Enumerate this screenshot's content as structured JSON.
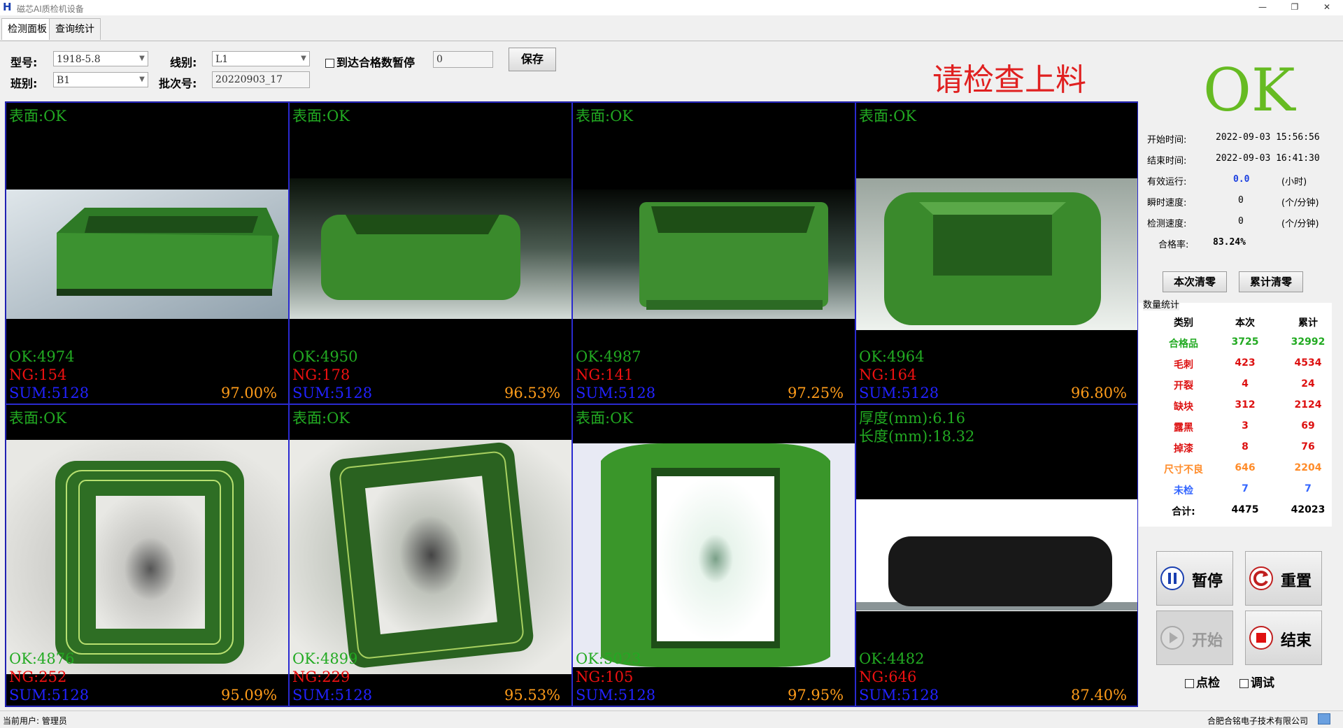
{
  "window": {
    "logo": "H",
    "title": "磁芯AI质检机设备",
    "min": "—",
    "restore": "❐",
    "close": "✕"
  },
  "tabs": [
    "检测面板",
    "查询统计"
  ],
  "form": {
    "model_label": "型号:",
    "model_value": "1918-5.8",
    "line_label": "线别:",
    "line_value": "L1",
    "shift_label": "班别:",
    "shift_value": "B1",
    "batch_label": "批次号:",
    "batch_value": "20220903_17",
    "pause_label": "到达合格数暂停",
    "pause_value": "0",
    "save_label": "保存"
  },
  "warning": "请检查上料",
  "result": "OK",
  "cameras": [
    {
      "top": "表面:OK",
      "top2": "",
      "ok": "OK:4974",
      "ng": "NG:154",
      "sum": "SUM:5128",
      "rate": "97.00%"
    },
    {
      "top": "表面:OK",
      "top2": "",
      "ok": "OK:4950",
      "ng": "NG:178",
      "sum": "SUM:5128",
      "rate": "96.53%"
    },
    {
      "top": "表面:OK",
      "top2": "",
      "ok": "OK:4987",
      "ng": "NG:141",
      "sum": "SUM:5128",
      "rate": "97.25%"
    },
    {
      "top": "表面:OK",
      "top2": "",
      "ok": "OK:4964",
      "ng": "NG:164",
      "sum": "SUM:5128",
      "rate": "96.80%"
    },
    {
      "top": "表面:OK",
      "top2": "",
      "ok": "OK:4876",
      "ng": "NG:252",
      "sum": "SUM:5128",
      "rate": "95.09%"
    },
    {
      "top": "表面:OK",
      "top2": "",
      "ok": "OK:4899",
      "ng": "NG:229",
      "sum": "SUM:5128",
      "rate": "95.53%"
    },
    {
      "top": "表面:OK",
      "top2": "",
      "ok": "OK:5023",
      "ng": "NG:105",
      "sum": "SUM:5128",
      "rate": "97.95%"
    },
    {
      "top": "厚度(mm):6.16",
      "top2": "长度(mm):18.32",
      "ok": "OK:4482",
      "ng": "NG:646",
      "sum": "SUM:5128",
      "rate": "87.40%"
    }
  ],
  "info": {
    "start_label": "开始时间:",
    "start_value": "2022-09-03 15:56:56",
    "end_label": "结束时间:",
    "end_value": "2022-09-03 16:41:30",
    "run_label": "有效运行:",
    "run_value": "0.0",
    "run_unit": "(小时)",
    "inst_label": "瞬时速度:",
    "inst_value": "0",
    "inst_unit": "(个/分钟)",
    "det_label": "检测速度:",
    "det_value": "0",
    "det_unit": "(个/分钟)",
    "rate_label": "合格率:",
    "rate_value": "83.24%"
  },
  "reset_buttons": {
    "current": "本次清零",
    "total": "累计清零"
  },
  "stats": {
    "title": "数量统计",
    "headers": [
      "类别",
      "本次",
      "累计"
    ],
    "rows": [
      {
        "name": "合格品",
        "cur": "3725",
        "total": "32992",
        "color": "#22aa22"
      },
      {
        "name": "毛刺",
        "cur": "423",
        "total": "4534",
        "color": "#dd1111"
      },
      {
        "name": "开裂",
        "cur": "4",
        "total": "24",
        "color": "#dd1111"
      },
      {
        "name": "缺块",
        "cur": "312",
        "total": "2124",
        "color": "#dd1111"
      },
      {
        "name": "露黑",
        "cur": "3",
        "total": "69",
        "color": "#dd1111"
      },
      {
        "name": "掉漆",
        "cur": "8",
        "total": "76",
        "color": "#dd1111"
      },
      {
        "name": "尺寸不良",
        "cur": "646",
        "total": "2204",
        "color": "#ff8c2a"
      },
      {
        "name": "未检",
        "cur": "7",
        "total": "7",
        "color": "#3366ff"
      }
    ],
    "sum_row": {
      "name": "合计:",
      "cur": "4475",
      "total": "42023"
    }
  },
  "controls": {
    "pause": "暂停",
    "reset": "重置",
    "start": "开始",
    "end": "结束",
    "spot": "点检",
    "debug": "调试"
  },
  "status": {
    "user": "当前用户: 管理员",
    "company": "合肥合铭电子技术有限公司"
  }
}
